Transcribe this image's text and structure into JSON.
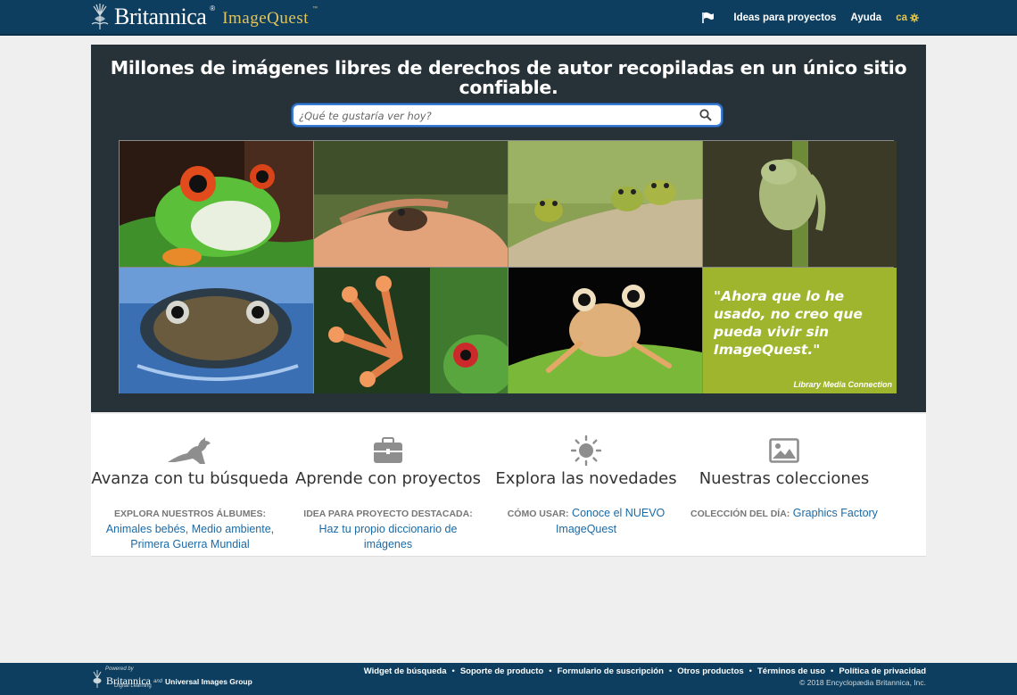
{
  "header": {
    "brand": "Britannica",
    "brand_reg": "®",
    "product": "ImageQuest",
    "product_tm": "™",
    "nav": {
      "projects": "Ideas para proyectos",
      "help": "Ayuda",
      "lang": "ca"
    },
    "icons": {
      "flag": "flag-icon",
      "settings": "gear-icon"
    }
  },
  "hero": {
    "title_line1": "Millones de imágenes libres de derechos de autor recopiladas en un único sitio",
    "title_line2": "confiable.",
    "search": {
      "placeholder": "¿Qué te gustaría ver hoy?",
      "value": ""
    },
    "tiles": [
      {
        "subject": "red-eyed tree frog"
      },
      {
        "subject": "small frog on hand"
      },
      {
        "subject": "three frogs on leaf"
      },
      {
        "subject": "frog on plant stem"
      },
      {
        "subject": "frog in water"
      },
      {
        "subject": "frog toe pads"
      },
      {
        "subject": "frog on leaf"
      }
    ],
    "quote": {
      "text": "\"Ahora que lo he usado, no creo que pueda vivir sin ImageQuest.\"",
      "source": "Library Media Connection"
    }
  },
  "features": [
    {
      "icon": "kangaroo-icon",
      "title": "Avanza con tu búsqueda",
      "label": "EXPLORA NUESTROS ÁLBUMES:",
      "link": "Animales bebés, Medio ambiente, Primera Guerra Mundial"
    },
    {
      "icon": "briefcase-icon",
      "title": "Aprende con proyectos",
      "label": "IDEA PARA PROYECTO DESTACADA:",
      "link": "Haz tu propio diccionario de imágenes"
    },
    {
      "icon": "sun-icon",
      "title": "Explora las novedades",
      "label": "CÓMO USAR:",
      "link": "Conoce el NUEVO ImageQuest"
    },
    {
      "icon": "image-icon",
      "title": "Nuestras colecciones",
      "label": "COLECCIÓN DEL DÍA:",
      "link": "Graphics Factory"
    }
  ],
  "footer": {
    "powered_by": "Powered by",
    "brand": "Britannica",
    "brand_sub": "Digital Learning",
    "and": "and",
    "partner": "Universal Images Group",
    "links": [
      "Widget de búsqueda",
      "Soporte de producto",
      "Formulario de suscripción",
      "Otros productos",
      "Términos de uso",
      "Política de privacidad"
    ],
    "separator": "•",
    "copyright": "© 2018 Encyclopædia Britannica, Inc."
  },
  "colors": {
    "header_bg": "#0d3e5f",
    "hero_bg": "#263238",
    "accent_gold": "#e2c35c",
    "link_blue": "#1b6aa5",
    "quote_green": "#9fb52e"
  }
}
